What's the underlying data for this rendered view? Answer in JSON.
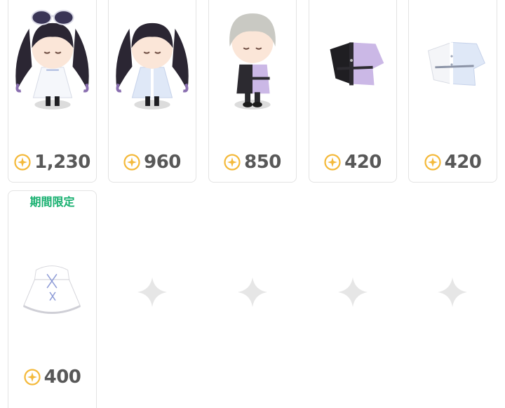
{
  "colors": {
    "card_border": "#e3e3e3",
    "price_text": "#585858",
    "coin": "#f4b93a",
    "limited_text": "#18b070",
    "sparkle": "#e6e6e6"
  },
  "items": [
    {
      "name": "twin-tail-avatar-with-sunglasses",
      "price": "1,230",
      "icon": "coin-icon"
    },
    {
      "name": "twin-tail-avatar-blue-dress",
      "price": "960",
      "icon": "coin-icon"
    },
    {
      "name": "silver-hair-avatar-lavender-outfit",
      "price": "850",
      "icon": "coin-icon"
    },
    {
      "name": "black-lavender-shirt",
      "price": "420",
      "icon": "coin-icon"
    },
    {
      "name": "white-blue-shirt",
      "price": "420",
      "icon": "coin-icon"
    },
    {
      "name": "white-frill-dress",
      "price": "400",
      "icon": "coin-icon",
      "badge": "期間限定"
    }
  ],
  "empty_slots": [
    "sparkle-icon",
    "sparkle-icon",
    "sparkle-icon",
    "sparkle-icon"
  ]
}
